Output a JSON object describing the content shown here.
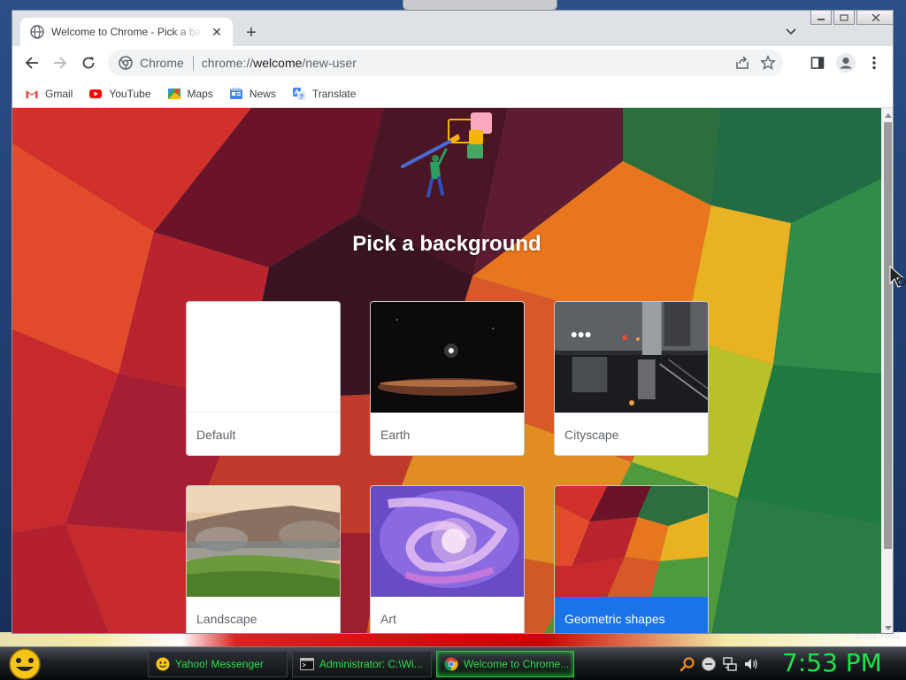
{
  "desktop": {
    "build_text": "Build 7601"
  },
  "browser": {
    "tab": {
      "title": "Welcome to Chrome - Pick a background",
      "close_glyph": "✕"
    },
    "new_tab_glyph": "+",
    "omnibox": {
      "origin_label": "Chrome",
      "url_prefix": "chrome://",
      "url_host": "welcome",
      "url_path": "/new-user"
    },
    "bookmarks": [
      {
        "label": "Gmail",
        "icon": "gmail-icon"
      },
      {
        "label": "YouTube",
        "icon": "youtube-icon"
      },
      {
        "label": "Maps",
        "icon": "maps-icon"
      },
      {
        "label": "News",
        "icon": "news-icon"
      },
      {
        "label": "Translate",
        "icon": "translate-icon"
      }
    ]
  },
  "page": {
    "heading": "Pick a background",
    "backgrounds": [
      {
        "label": "Default",
        "selected": false
      },
      {
        "label": "Earth",
        "selected": false
      },
      {
        "label": "Cityscape",
        "selected": false
      },
      {
        "label": "Landscape",
        "selected": false
      },
      {
        "label": "Art",
        "selected": false
      },
      {
        "label": "Geometric shapes",
        "selected": true
      }
    ],
    "selected_color": "#1a73e8"
  },
  "taskbar": {
    "items": [
      {
        "label": "Yahoo! Messenger",
        "icon": "yahoo-messenger-icon",
        "active": false
      },
      {
        "label": "Administrator: C:\\Wi...",
        "icon": "command-prompt-icon",
        "active": false
      },
      {
        "label": "Welcome to Chrome...",
        "icon": "chrome-icon",
        "active": true
      }
    ],
    "clock": "7:53 PM",
    "accent_color": "#22e04a"
  }
}
